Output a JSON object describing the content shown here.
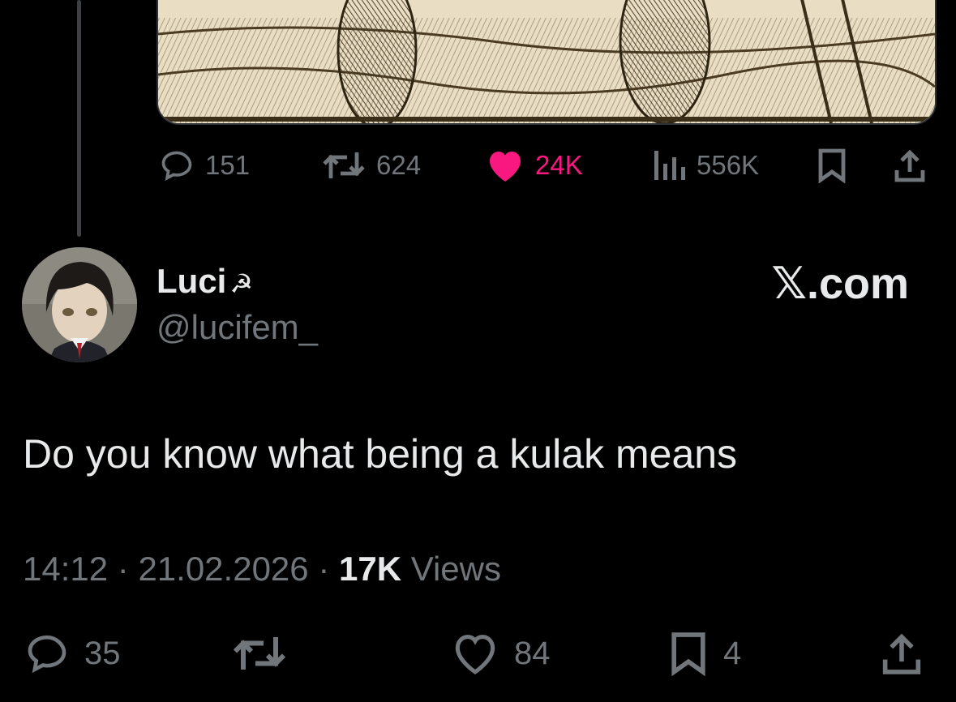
{
  "previous_tweet": {
    "image_description": "engraving",
    "actions": {
      "replies": "151",
      "reposts": "624",
      "likes": "24K",
      "views": "556K"
    }
  },
  "tweet": {
    "author": {
      "display_name": "Luci",
      "emoji": "☭",
      "handle": "@lucifem_"
    },
    "brand": "𝕏.com",
    "text": "Do you know what being a kulak means",
    "time": "14:12",
    "separator": " · ",
    "date": "21.02.2026",
    "views_count": "17K",
    "views_label": " Views",
    "actions": {
      "replies": "35",
      "reposts": "",
      "likes": "84",
      "bookmarks": "4"
    }
  },
  "colors": {
    "background": "#000000",
    "text_primary": "#e7e9ea",
    "text_secondary": "#71767b",
    "like_pink": "#f91880"
  },
  "icons": [
    "reply-icon",
    "repost-icon",
    "heart-icon",
    "views-icon",
    "bookmark-icon",
    "share-icon"
  ]
}
